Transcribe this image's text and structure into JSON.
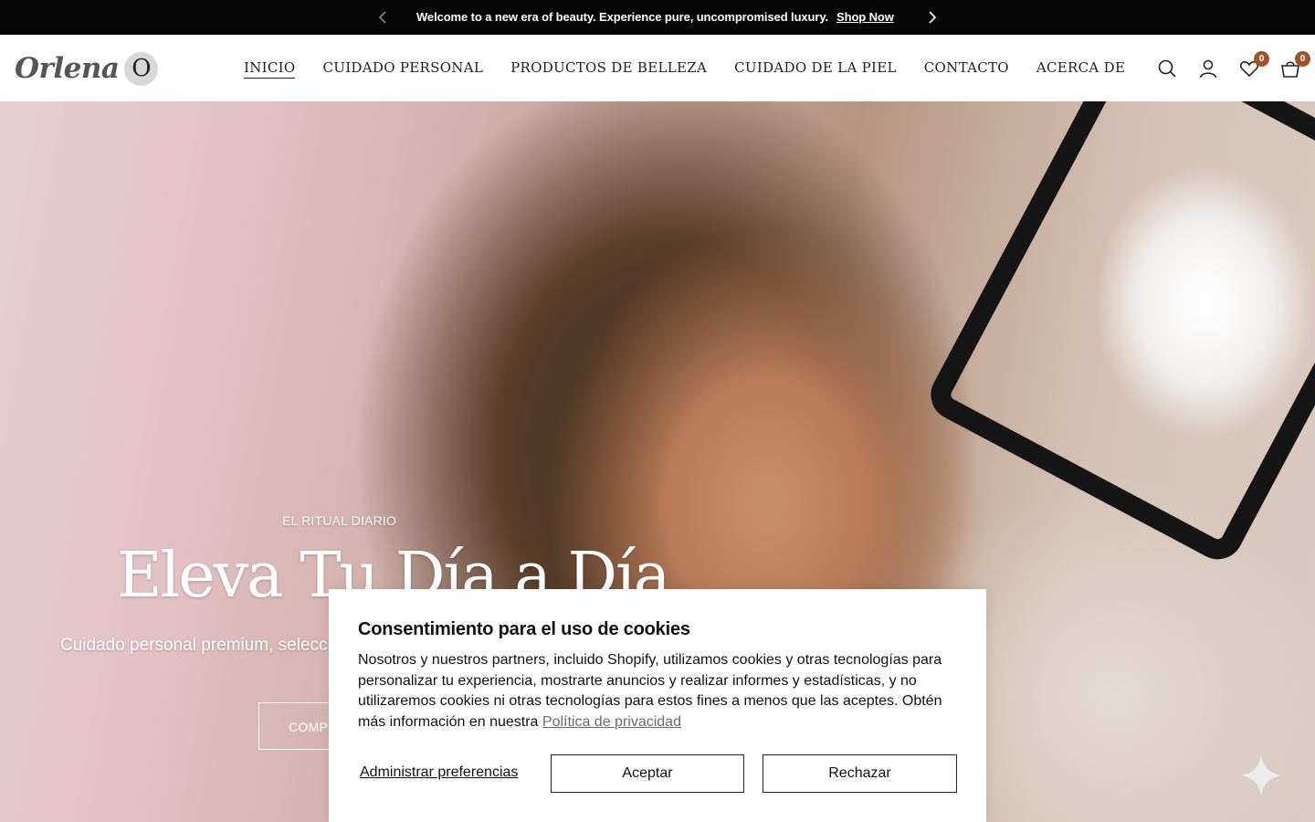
{
  "announcement": {
    "text": "Welcome to a new era of beauty. Experience pure, uncompromised luxury.",
    "link": "Shop Now"
  },
  "header": {
    "logo_text": "Orlena",
    "logo_mark": "O",
    "nav": [
      "INICIO",
      "CUIDADO PERSONAL",
      "PRODUCTOS DE BELLEZA",
      "CUIDADO DE LA PIEL",
      "CONTACTO",
      "ACERCA DE"
    ],
    "wishlist_count": "0",
    "cart_count": "0",
    "icons": [
      "search-icon",
      "account-icon",
      "heart-icon",
      "bag-icon"
    ]
  },
  "hero": {
    "eyebrow": "EL RITUAL DIARIO",
    "headline": "Eleva Tu Día a Día",
    "subtitle": "Cuidado personal premium, selecció",
    "cta": "COMPR"
  },
  "cookie": {
    "title": "Consentimiento para el uso de cookies",
    "body": "Nosotros y nuestros partners, incluido Shopify, utilizamos cookies y otras tecnologías para personalizar tu experiencia, mostrarte anuncios y realizar informes y estadísticas, y no utilizaremos cookies ni otras tecnologías para estos fines a menos que las aceptes. Obtén más información en nuestra",
    "policy_link": "Política de privacidad",
    "manage": "Administrar preferencias",
    "accept": "Aceptar",
    "reject": "Rechazar"
  },
  "colors": {
    "announcement_bg": "#050505",
    "badge": "#a0522d",
    "text": "#111111"
  }
}
